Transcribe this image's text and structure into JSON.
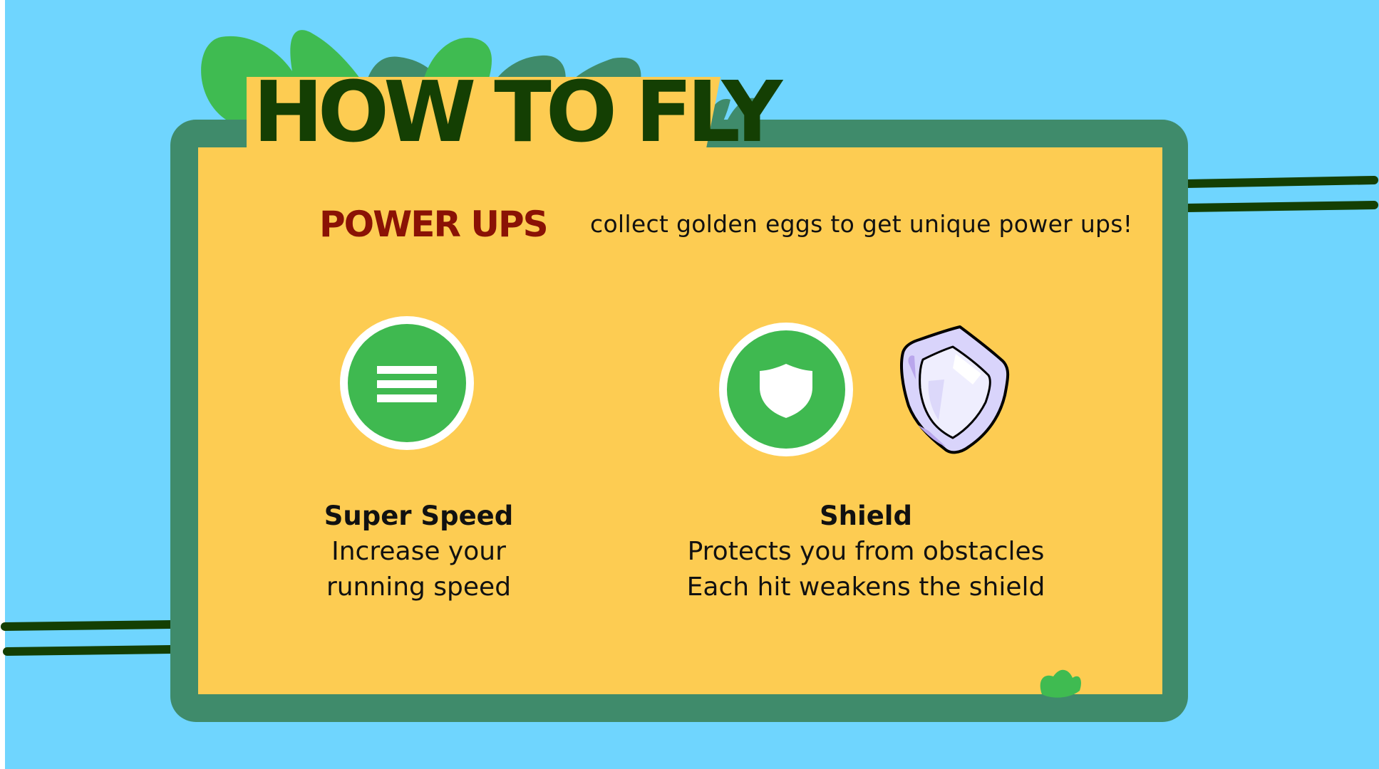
{
  "page": {
    "title": "HOW TO FLY"
  },
  "section": {
    "label": "POWER UPS",
    "description": "collect golden eggs to get unique power ups!"
  },
  "powerups": [
    {
      "icon": "menu-lines-icon",
      "name": "Super Speed",
      "lines": [
        "Increase your",
        "running speed"
      ]
    },
    {
      "icon": "shield-icon",
      "name": "Shield",
      "lines": [
        "Protects you from obstacles",
        "Each hit weakens the shield"
      ]
    }
  ],
  "colors": {
    "sky": "#6fd5fe",
    "frame": "#3f8b6b",
    "panel": "#fdcc52",
    "title": "#143f03",
    "section_label": "#8a1205",
    "icon_circle": "#3fb950",
    "leaf_light": "#3fbb51",
    "leaf_dark": "#3f8b6b"
  }
}
